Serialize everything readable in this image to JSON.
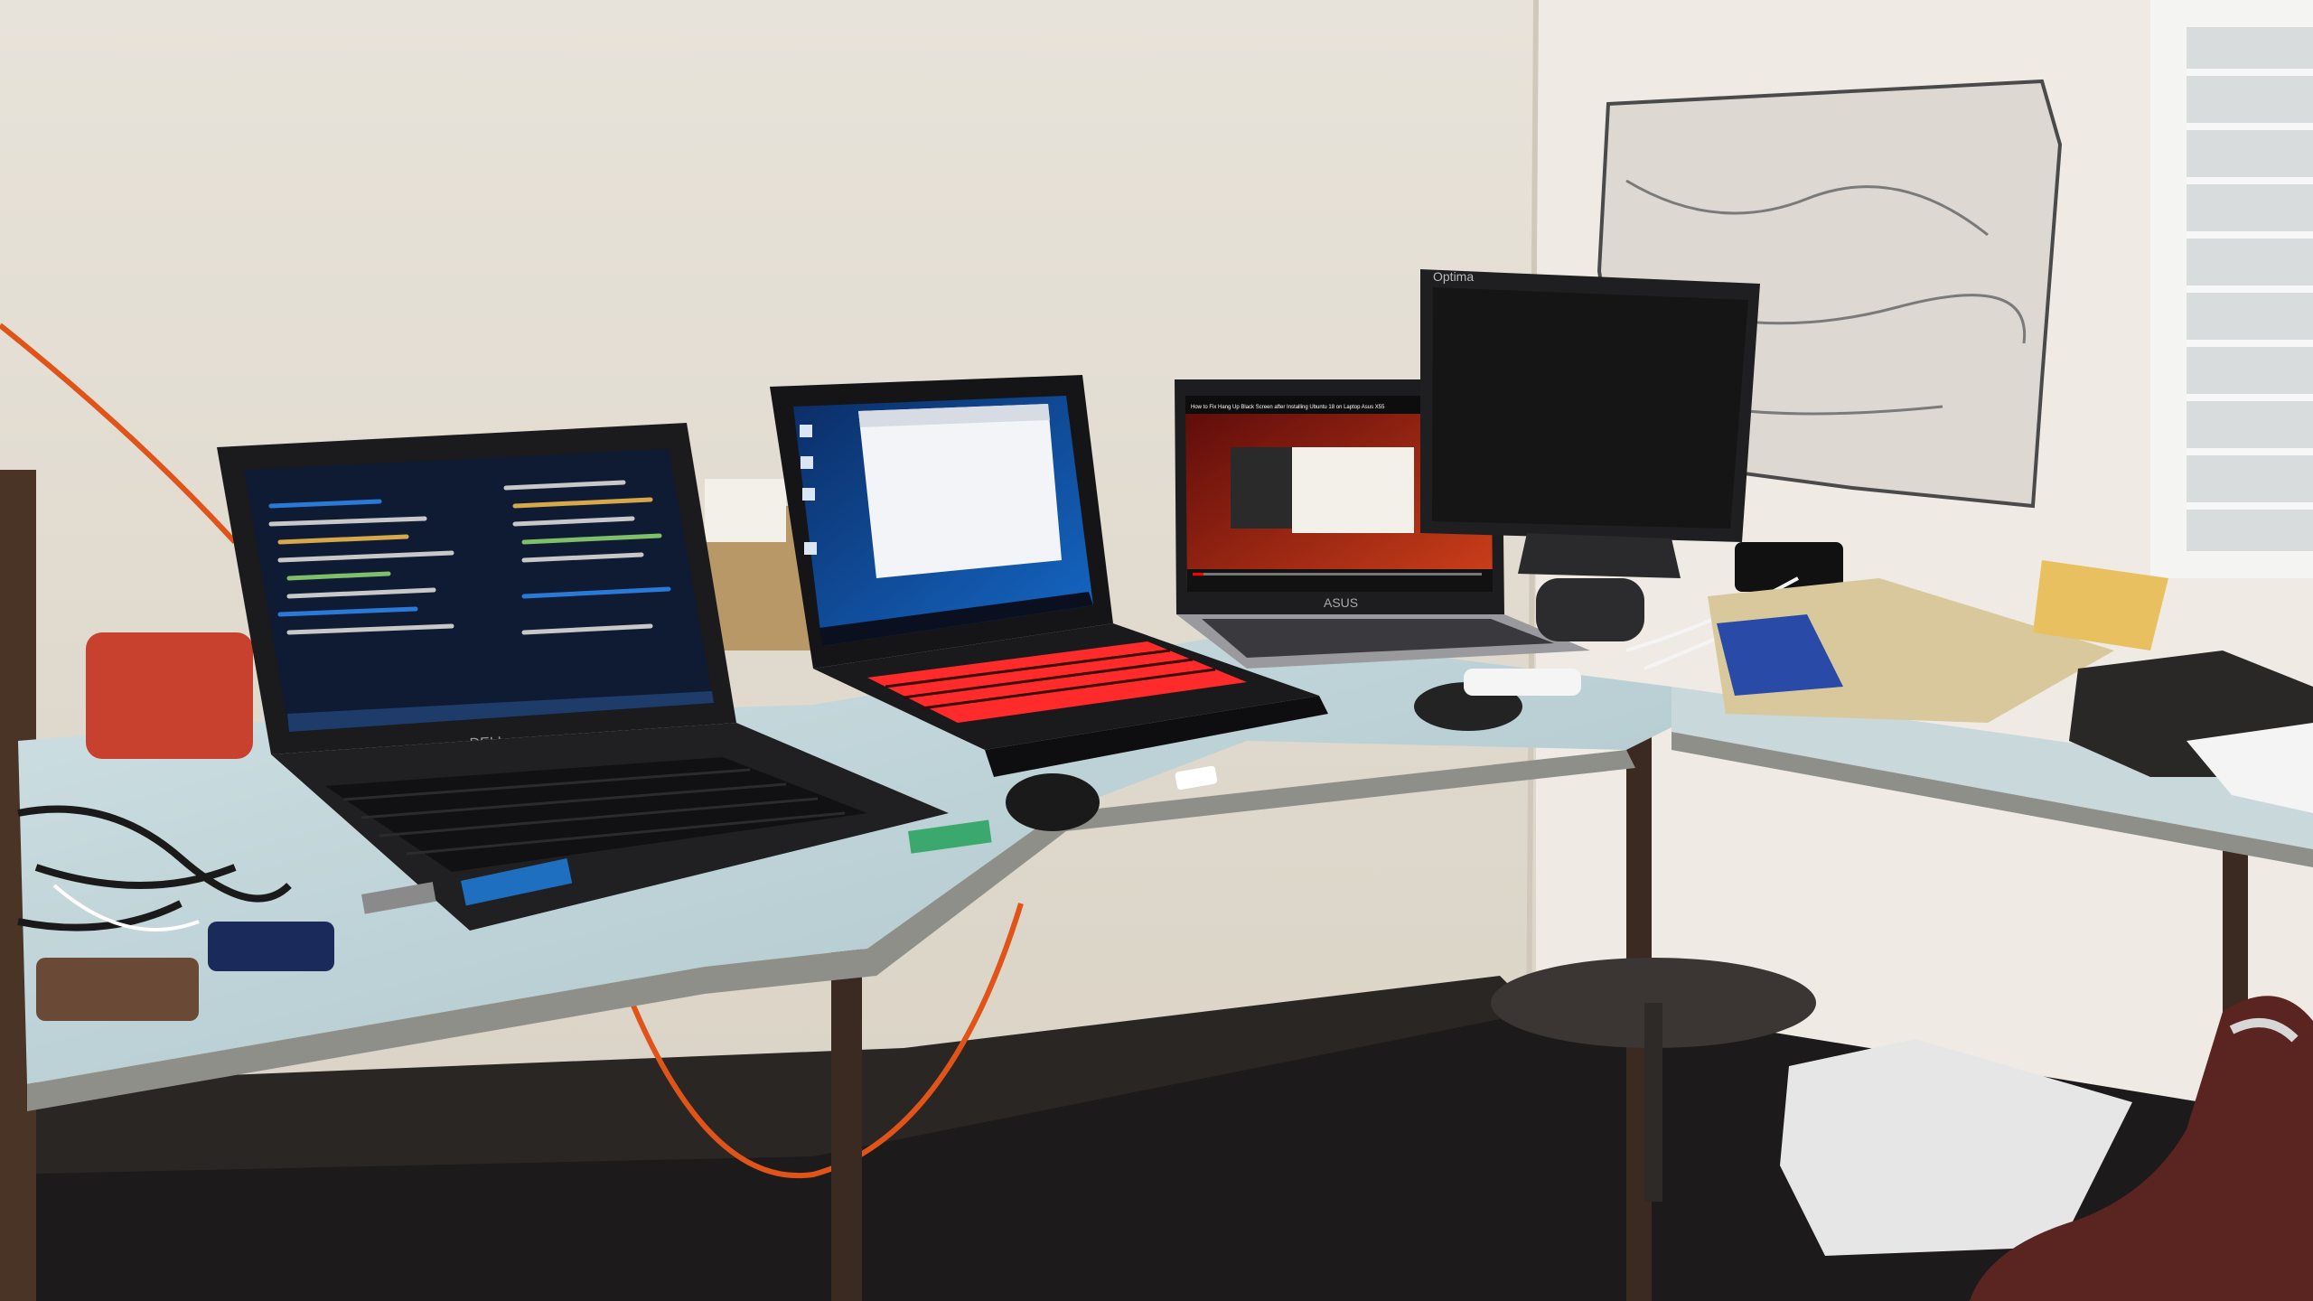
{
  "photo": {
    "subject": "desk-with-laptops",
    "walls": "#ece8e0",
    "floor": "#1c1a1a",
    "table_top": "#bcd4d8"
  },
  "laptops": [
    {
      "brand_label": "DELL",
      "screen_content": "code-editor",
      "screen_bg": "#0f1a33",
      "accent": "#2a79d6"
    },
    {
      "brand_label": "",
      "screen_content": "windows-10-desktop",
      "screen_bg": "#0a3a78",
      "keyboard_backlight": "#ff2a2a"
    },
    {
      "brand_label": "ASUS",
      "screen_content": "video-player",
      "video_title": "How to Fix Hang Up Black Screen after Installing Ubuntu 18 on Laptop Asus X55",
      "screen_bg": "#b0220e"
    }
  ],
  "monitor": {
    "brand_label": "Optima",
    "screen_bg": "#151515"
  },
  "peripherals": [
    {
      "type": "mouse",
      "color": "#1a1a1a"
    },
    {
      "type": "mouse",
      "color": "#232323"
    },
    {
      "type": "usb-drive",
      "color": "#ffffff"
    },
    {
      "type": "mobile-phone",
      "color": "#1a2a5a"
    }
  ],
  "cables": {
    "extension_cord_color": "#e0541a"
  }
}
